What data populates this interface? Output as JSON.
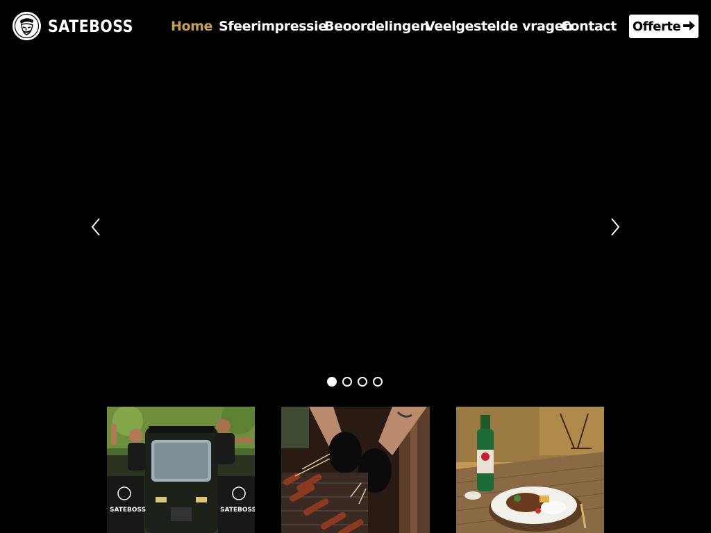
{
  "brand": {
    "name": "SATEBOSS",
    "logo_icon": "chef-mascot-icon"
  },
  "nav": {
    "items": [
      {
        "label": "Home",
        "active": true
      },
      {
        "label": "Sfeerimpressie",
        "active": false
      },
      {
        "label": "Beoordelingen",
        "active": false
      },
      {
        "label": "Veelgestelde vragen",
        "active": false
      },
      {
        "label": "Contact",
        "active": false
      }
    ],
    "cta_label": "Offerte",
    "cta_icon": "arrow-right-icon"
  },
  "carousel": {
    "prev_icon": "chevron-left-icon",
    "next_icon": "chevron-right-icon",
    "slide_count": 4,
    "active_slide": 1
  },
  "tiles": [
    {
      "name": "tuktuk-owners-photo",
      "labels": [
        "SATEBOSS",
        "SATEBOSS"
      ]
    },
    {
      "name": "grill-skewers-photo"
    },
    {
      "name": "sate-dish-beer-photo"
    }
  ],
  "colors": {
    "accent": "#c8a24a",
    "background": "#000000",
    "cta_bg": "#ffffff"
  }
}
